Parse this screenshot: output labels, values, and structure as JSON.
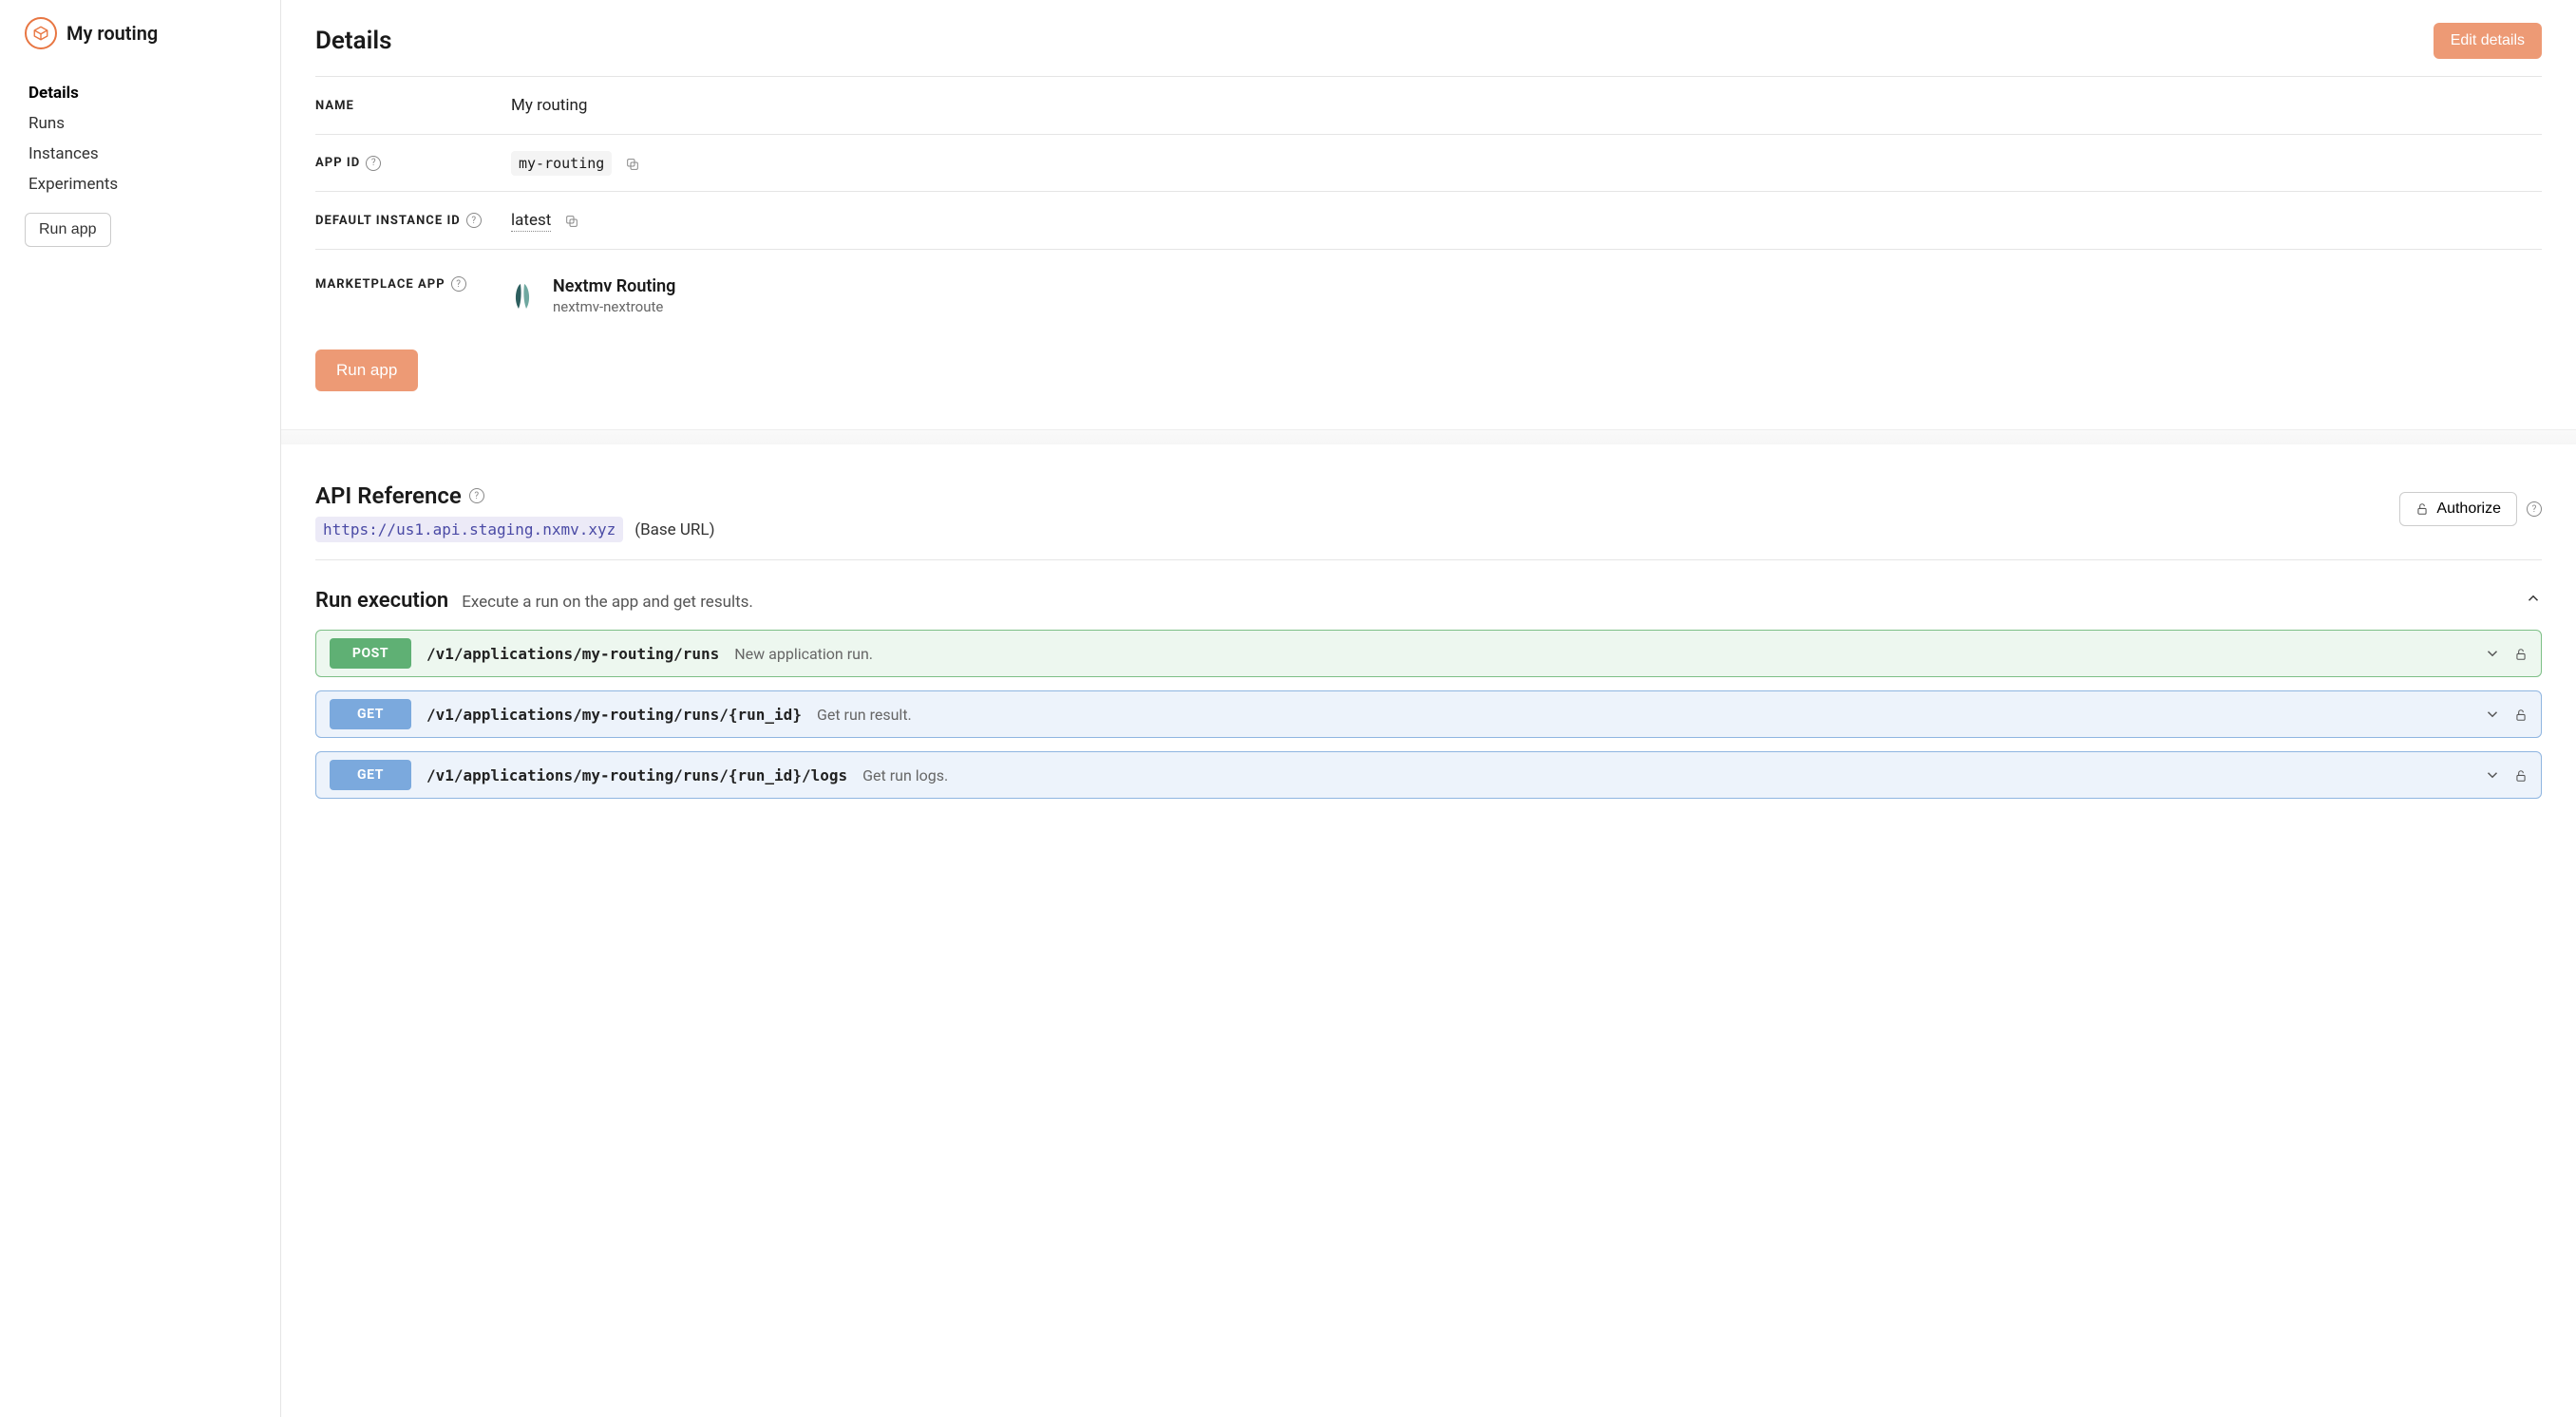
{
  "sidebar": {
    "app_title": "My routing",
    "nav": [
      {
        "label": "Details",
        "active": true
      },
      {
        "label": "Runs",
        "active": false
      },
      {
        "label": "Instances",
        "active": false
      },
      {
        "label": "Experiments",
        "active": false
      }
    ],
    "run_app_label": "Run app"
  },
  "header": {
    "title": "Details",
    "edit_button": "Edit details"
  },
  "details": {
    "name_label": "NAME",
    "name_value": "My routing",
    "app_id_label": "APP ID",
    "app_id_value": "my-routing",
    "default_instance_label": "DEFAULT INSTANCE ID",
    "default_instance_value": "latest",
    "marketplace_label": "MARKETPLACE APP",
    "marketplace_name": "Nextmv Routing",
    "marketplace_id": "nextmv-nextroute"
  },
  "actions": {
    "run_app_label": "Run app"
  },
  "api": {
    "title": "API Reference",
    "base_url": "https://us1.api.staging.nxmv.xyz",
    "base_url_label": "(Base URL)",
    "authorize_label": "Authorize",
    "section": {
      "title": "Run execution",
      "desc": "Execute a run on the app and get results."
    },
    "endpoints": [
      {
        "method": "POST",
        "class": "post",
        "path": "/v1/applications/my-routing/runs",
        "desc": "New application run."
      },
      {
        "method": "GET",
        "class": "get",
        "path": "/v1/applications/my-routing/runs/{run_id}",
        "desc": "Get run result."
      },
      {
        "method": "GET",
        "class": "get",
        "path": "/v1/applications/my-routing/runs/{run_id}/logs",
        "desc": "Get run logs."
      }
    ]
  },
  "colors": {
    "accent": "#e87642",
    "post": "#5fb074",
    "get": "#7ba9dd"
  }
}
